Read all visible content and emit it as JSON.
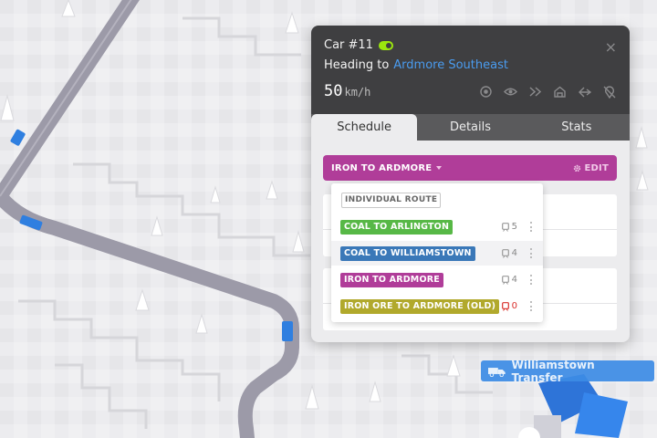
{
  "car": {
    "title": "Car #11",
    "heading_prefix": "Heading to",
    "destination": "Ardmore Southeast",
    "speed_value": "50",
    "speed_unit": "km/h",
    "action_icons": [
      "target-icon",
      "eye-icon",
      "fast-forward-icon",
      "depot-icon",
      "reverse-icon",
      "no-location-icon"
    ]
  },
  "tabs": [
    {
      "label": "Schedule",
      "active": true
    },
    {
      "label": "Details",
      "active": false
    },
    {
      "label": "Stats",
      "active": false
    }
  ],
  "route_bar": {
    "current_route": "IRON TO ARDMORE",
    "edit_label": "EDIT",
    "color": "#b03d99"
  },
  "dropdown": {
    "individual_label": "INDIVIDUAL ROUTE",
    "routes": [
      {
        "label": "COAL TO ARLINGTON",
        "color": "#57b846",
        "count": "5"
      },
      {
        "label": "COAL TO WILLIAMSTOWN",
        "color": "#3a78b8",
        "count": "4"
      },
      {
        "label": "IRON TO ARDMORE",
        "color": "#b03d99",
        "count": "4"
      },
      {
        "label": "IRON ORE TO ARDMORE (OLD)",
        "color": "#b1a92c",
        "count": "0"
      }
    ]
  },
  "map": {
    "transfer_label": "Williamstown Transfer"
  }
}
